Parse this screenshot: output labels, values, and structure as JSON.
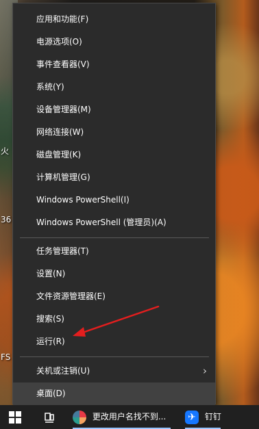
{
  "desktop": {
    "labels": {
      "fire": "火",
      "three60": "36",
      "fs": "FS"
    }
  },
  "context_menu": {
    "group1": [
      {
        "label": "应用和功能(F)"
      },
      {
        "label": "电源选项(O)"
      },
      {
        "label": "事件查看器(V)"
      },
      {
        "label": "系统(Y)"
      },
      {
        "label": "设备管理器(M)"
      },
      {
        "label": "网络连接(W)"
      },
      {
        "label": "磁盘管理(K)"
      },
      {
        "label": "计算机管理(G)"
      },
      {
        "label": "Windows PowerShell(I)"
      },
      {
        "label": "Windows PowerShell (管理员)(A)"
      }
    ],
    "group2": [
      {
        "label": "任务管理器(T)"
      },
      {
        "label": "设置(N)"
      },
      {
        "label": "文件资源管理器(E)"
      },
      {
        "label": "搜索(S)"
      },
      {
        "label": "运行(R)"
      }
    ],
    "group3": [
      {
        "label": "关机或注销(U)",
        "submenu_icon": "chevron-right-icon"
      },
      {
        "label": "桌面(D)"
      }
    ],
    "selected_item": "桌面(D)"
  },
  "annotation": {
    "arrow_color": "#e41e1e",
    "target_item": "运行(R)"
  },
  "taskbar": {
    "start_icon": "windows-start-icon",
    "task_view_icon": "task-view-icon",
    "apps": [
      {
        "label": "更改用户名找不到...",
        "icon": "colorful-circle-app-icon"
      },
      {
        "label": "钉钉",
        "icon": "dingtalk-icon"
      }
    ]
  }
}
